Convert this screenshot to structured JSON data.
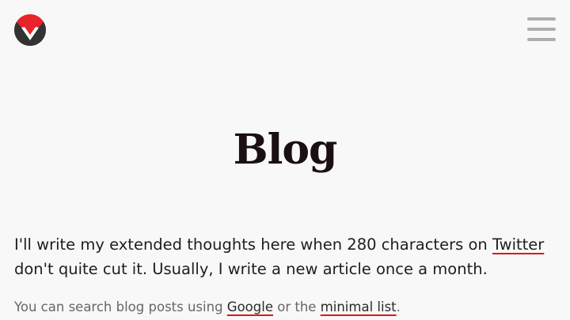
{
  "header": {
    "logo_icon": "m-logo-icon",
    "menu_icon": "hamburger-menu-icon"
  },
  "main": {
    "title": "Blog",
    "intro": {
      "text_before_link": "I'll write my extended thoughts here when 280 characters on ",
      "link_text": "Twitter",
      "text_after_link": " don't quite cut it. Usually, I write a new article once a month."
    },
    "search_note": {
      "text_before": "You can search blog posts using ",
      "google_link": "Google",
      "text_middle": " or the ",
      "minimal_list_link": "minimal list",
      "text_after": "."
    }
  },
  "colors": {
    "background": "#f8f8f8",
    "logo_red": "#e8232a",
    "logo_dark": "#333333",
    "link_underline": "#d81a1a",
    "menu_bars": "#aeaeae",
    "title": "#1a0f14"
  }
}
